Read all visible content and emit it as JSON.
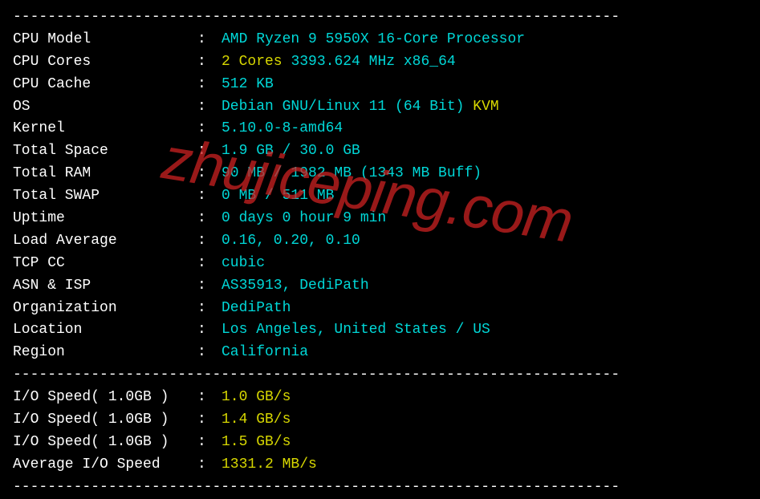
{
  "divider": "----------------------------------------------------------------------",
  "system": {
    "cpu_model": {
      "label": "CPU Model",
      "value": "AMD Ryzen 9 5950X 16-Core Processor"
    },
    "cpu_cores": {
      "label": "CPU Cores",
      "cores": "2 Cores",
      "freq": "3393.624 MHz x86_64"
    },
    "cpu_cache": {
      "label": "CPU Cache",
      "value": "512 KB"
    },
    "os": {
      "label": "OS",
      "name": "Debian GNU/Linux 11 (64 Bit)",
      "virt": "KVM"
    },
    "kernel": {
      "label": "Kernel",
      "value": "5.10.0-8-amd64"
    },
    "total_space": {
      "label": "Total Space",
      "value": "1.9 GB / 30.0 GB"
    },
    "total_ram": {
      "label": "Total RAM",
      "value": "90 MB / 1982 MB (1343 MB Buff)"
    },
    "total_swap": {
      "label": "Total SWAP",
      "value": "0 MB / 511 MB"
    },
    "uptime": {
      "label": "Uptime",
      "value": "0 days 0 hour 9 min"
    },
    "load_average": {
      "label": "Load Average",
      "value": "0.16, 0.20, 0.10"
    },
    "tcp_cc": {
      "label": "TCP CC",
      "value": "cubic"
    },
    "asn_isp": {
      "label": "ASN & ISP",
      "value": "AS35913, DediPath"
    },
    "organization": {
      "label": "Organization",
      "value": "DediPath"
    },
    "location": {
      "label": "Location",
      "value": "Los Angeles, United States / US"
    },
    "region": {
      "label": "Region",
      "value": "California"
    }
  },
  "io": {
    "speed1": {
      "label": "I/O Speed( 1.0GB )",
      "value": "1.0 GB/s"
    },
    "speed2": {
      "label": "I/O Speed( 1.0GB )",
      "value": "1.4 GB/s"
    },
    "speed3": {
      "label": "I/O Speed( 1.0GB )",
      "value": "1.5 GB/s"
    },
    "average": {
      "label": "Average I/O Speed",
      "value": "1331.2 MB/s"
    }
  },
  "watermark": "zhujiceping.com"
}
